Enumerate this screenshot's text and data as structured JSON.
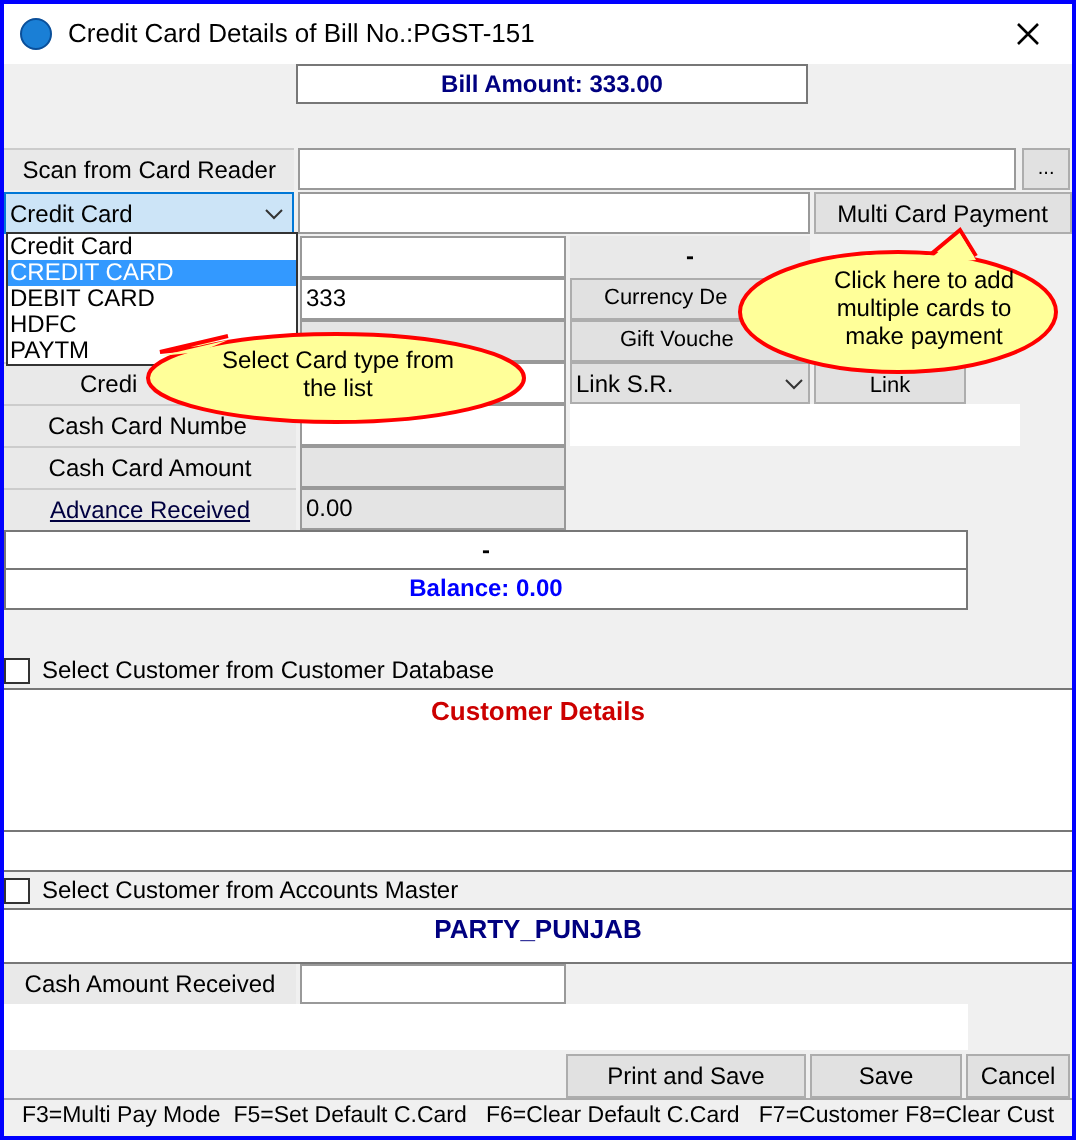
{
  "window": {
    "title": "Credit Card Details of Bill No.:PGST-151"
  },
  "bill_amount": "Bill Amount: 333.00",
  "scan": {
    "label": "Scan from Card Reader",
    "button": "..."
  },
  "card_type": {
    "value": "Credit Card",
    "expanded": true
  },
  "card_type_options": [
    {
      "label": "Credit Card",
      "selected": false
    },
    {
      "label": "CREDIT CARD",
      "selected": true
    },
    {
      "label": "DEBIT CARD",
      "selected": false
    },
    {
      "label": "HDFC",
      "selected": false
    },
    {
      "label": "PAYTM",
      "selected": false
    }
  ],
  "multi_card_button": "Multi Card Payment",
  "detail_rows": [
    {
      "disabled": false,
      "middle": {
        "kind": "label",
        "text": "-"
      }
    },
    {
      "value": "333",
      "disabled": false,
      "middle": {
        "kind": "button",
        "text": "Currency De"
      }
    },
    {
      "disabled": true,
      "middle": {
        "kind": "button",
        "text": "Gift Vouche"
      }
    },
    {
      "label": {
        "kind": "plain",
        "text": "Credi"
      },
      "disabled": false,
      "middle": {
        "kind": "select",
        "text": "Link S.R."
      },
      "right": {
        "kind": "button",
        "text": "Link"
      }
    },
    {
      "label": {
        "kind": "plain",
        "text": "Cash Card Numbe"
      },
      "disabled": false,
      "middle": {
        "kind": "blank"
      }
    },
    {
      "label": {
        "kind": "plain",
        "text": "Cash Card Amount"
      },
      "disabled": true
    },
    {
      "label": {
        "kind": "link",
        "text": "Advance Received"
      },
      "value": "0.00",
      "disabled": true
    }
  ],
  "summary": "-",
  "balance": "Balance: 0.00",
  "customer_db": {
    "label": "Select Customer from Customer Database",
    "checked": false
  },
  "customer_details_title": "Customer Details",
  "accounts_master": {
    "label": "Select Customer from Accounts Master",
    "checked": false
  },
  "party": "PARTY_PUNJAB",
  "cash_received": {
    "label": "Cash Amount Received"
  },
  "buttons": [
    "Print and Save",
    "Save",
    "Cancel"
  ],
  "status_bar": "F3=Multi Pay Mode  F5=Set Default C.Card   F6=Clear Default C.Card   F7=Customer F8=Clear Cust",
  "callouts": [
    {
      "text": "Select Card type from the list"
    },
    {
      "text": "Click here to add multiple cards to make payment"
    }
  ]
}
